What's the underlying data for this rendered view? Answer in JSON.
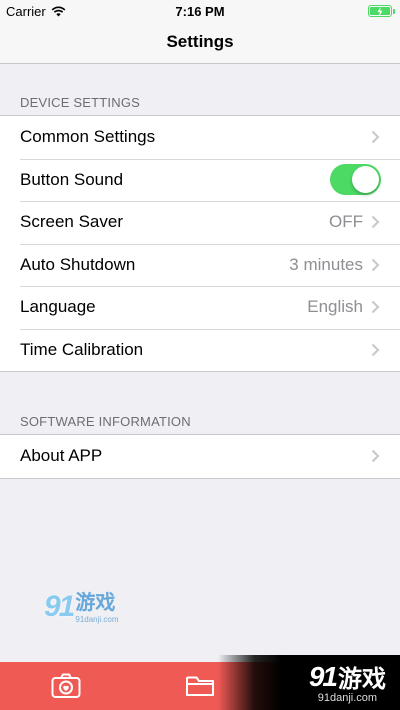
{
  "status_bar": {
    "carrier": "Carrier",
    "time": "7:16 PM",
    "battery_color": "#4cd964"
  },
  "nav": {
    "title": "Settings"
  },
  "device_settings": {
    "header": "DEVICE SETTINGS",
    "rows": [
      {
        "label": "Common Settings",
        "value": ""
      },
      {
        "label": "Button Sound",
        "toggle_on": true
      },
      {
        "label": "Screen Saver",
        "value": "OFF"
      },
      {
        "label": "Auto Shutdown",
        "value": "3 minutes"
      },
      {
        "label": "Language",
        "value": "English"
      },
      {
        "label": "Time Calibration",
        "value": ""
      }
    ]
  },
  "software_information": {
    "header": "SOFTWARE INFORMATION",
    "rows": [
      {
        "label": "About APP",
        "value": ""
      }
    ]
  },
  "tab_bar": {
    "background": "#f05a55",
    "items": [
      {
        "icon": "camera-icon"
      },
      {
        "icon": "folder-icon"
      }
    ]
  },
  "watermark": {
    "number": "91",
    "text": "游戏",
    "url": "91danji.com"
  },
  "brand": {
    "number": "91",
    "text": "游戏",
    "url": "91danji.com"
  },
  "colors": {
    "toggle_on": "#4cd964",
    "accent": "#f05a55"
  }
}
